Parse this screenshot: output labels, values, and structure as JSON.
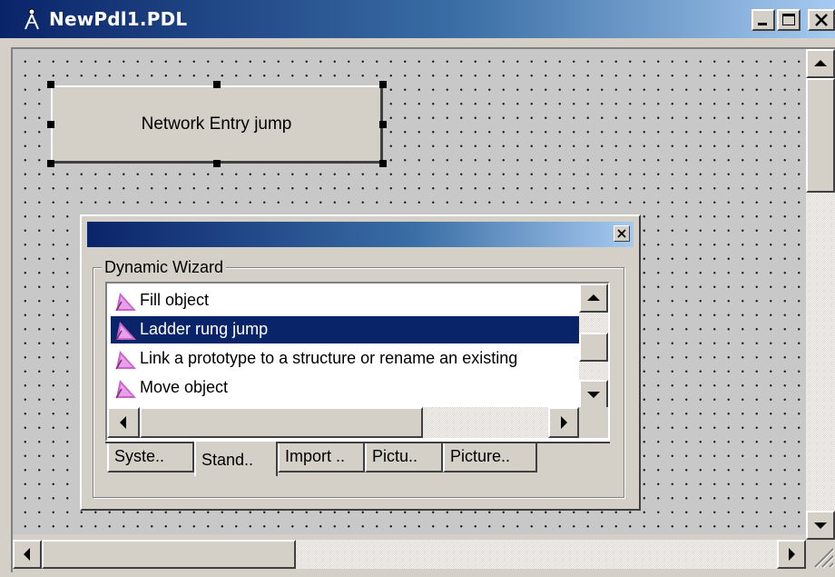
{
  "window": {
    "title": "NewPdl1.PDL",
    "icon": "compass-icon",
    "controls": [
      "minimize-icon",
      "maximize-icon",
      "close-icon"
    ]
  },
  "canvas": {
    "selected_button": {
      "label": "Network Entry jump"
    }
  },
  "wizard": {
    "group_label": "Dynamic Wizard",
    "items": [
      {
        "label": "Fill object",
        "icon": "wand-icon",
        "selected": false
      },
      {
        "label": "Ladder rung jump",
        "icon": "wand-icon",
        "selected": true
      },
      {
        "label": "Link a prototype to a structure or rename an existing",
        "icon": "wand-icon",
        "selected": false
      },
      {
        "label": "Move object",
        "icon": "wand-icon",
        "selected": false
      }
    ],
    "tabs": [
      {
        "label": "Syste..",
        "active": false
      },
      {
        "label": "Stand..",
        "active": true
      },
      {
        "label": "Import ..",
        "active": false
      },
      {
        "label": "Pictu..",
        "active": false
      },
      {
        "label": "Picture..",
        "active": false
      }
    ]
  },
  "colors": {
    "title_start": "#0a246a",
    "title_end": "#a6caf0",
    "selection": "#0a246a",
    "face": "#d4d0c8"
  }
}
